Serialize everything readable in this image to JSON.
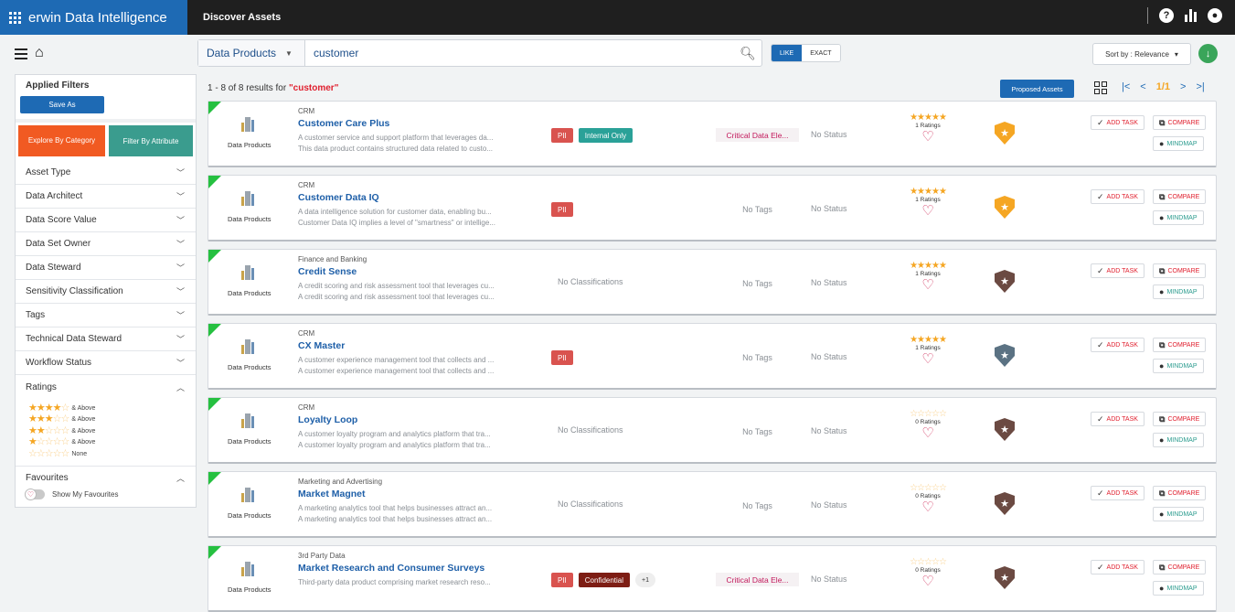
{
  "app": {
    "title": "erwin Data Intelligence",
    "page_title": "Discover Assets"
  },
  "header_icons": [
    "help-icon",
    "metrics-icon",
    "user-icon"
  ],
  "search": {
    "asset_type": "Data Products",
    "query": "customer",
    "match_modes": [
      "LIKE",
      "EXACT"
    ],
    "active_mode": "LIKE",
    "sort_by": "Sort by : Relevance"
  },
  "sidebar": {
    "applied_filters_label": "Applied Filters",
    "save_as_label": "Save As",
    "explore_by_category_label": "Explore By Category",
    "filter_by_attribute_label": "Filter By Attribute",
    "facets": [
      "Asset Type",
      "Data Architect",
      "Data Score Value",
      "Data Set Owner",
      "Data Steward",
      "Sensitivity Classification",
      "Tags",
      "Technical Data Steward",
      "Workflow Status"
    ],
    "ratings_label": "Ratings",
    "rating_filters": [
      {
        "stars": 4,
        "label": "& Above"
      },
      {
        "stars": 3,
        "label": "& Above"
      },
      {
        "stars": 2,
        "label": "& Above"
      },
      {
        "stars": 1,
        "label": "& Above"
      },
      {
        "stars": 0,
        "label": "None"
      }
    ],
    "favourites_label": "Favourites",
    "show_favourites_label": "Show My Favourites"
  },
  "results": {
    "summary_prefix": "1 - 8 of 8 results for ",
    "summary_query": "\"customer\"",
    "proposed_assets_label": "Proposed Assets",
    "pagination": {
      "first": "|<",
      "prev": "<",
      "page": "1/1",
      "next": ">",
      "last": ">|"
    }
  },
  "action_labels": {
    "add_task": "ADD TASK",
    "compare": "COMPARE",
    "mindmap": "MINDMAP"
  },
  "asset_type_label": "Data Products",
  "items": [
    {
      "domain": "CRM",
      "name": "Customer Care Plus",
      "desc1": "A customer service and support platform that leverages da...",
      "desc2": "This data product contains structured data related to custo...",
      "classifications": [
        "PII",
        "Internal Only"
      ],
      "no_class": "",
      "tags": "Critical Data Ele...",
      "status": "No Status",
      "stars": 5,
      "ratings": "1 Ratings",
      "shield": "gold"
    },
    {
      "domain": "CRM",
      "name": "Customer Data IQ",
      "desc1": "A data intelligence solution for customer data, enabling bu...",
      "desc2": "Customer Data IQ implies a level of \"smartness\" or intellige...",
      "classifications": [
        "PII"
      ],
      "no_class": "",
      "tags": "No Tags",
      "status": "No Status",
      "stars": 5,
      "ratings": "1 Ratings",
      "shield": "gold"
    },
    {
      "domain": "Finance and Banking",
      "name": "Credit Sense",
      "desc1": "A credit scoring and risk assessment tool that leverages cu...",
      "desc2": "A credit scoring and risk assessment tool that leverages cu...",
      "classifications": [],
      "no_class": "No Classifications",
      "tags": "No Tags",
      "status": "No Status",
      "stars": 5,
      "ratings": "1 Ratings",
      "shield": "brown"
    },
    {
      "domain": "CRM",
      "name": "CX Master",
      "desc1": "A customer experience management tool that collects and ...",
      "desc2": "A customer experience management tool that collects and ...",
      "classifications": [
        "PII"
      ],
      "no_class": "",
      "tags": "No Tags",
      "status": "No Status",
      "stars": 5,
      "ratings": "1 Ratings",
      "shield": "slate"
    },
    {
      "domain": "CRM",
      "name": "Loyalty Loop",
      "desc1": "A customer loyalty program and analytics platform that tra...",
      "desc2": "A customer loyalty program and analytics platform that tra...",
      "classifications": [],
      "no_class": "No Classifications",
      "tags": "No Tags",
      "status": "No Status",
      "stars": 0,
      "ratings": "0 Ratings",
      "shield": "brown"
    },
    {
      "domain": "Marketing and Advertising",
      "name": "Market Magnet",
      "desc1": "A marketing analytics tool that helps businesses attract an...",
      "desc2": "A marketing analytics tool that helps businesses attract an...",
      "classifications": [],
      "no_class": "No Classifications",
      "tags": "No Tags",
      "status": "No Status",
      "stars": 0,
      "ratings": "0 Ratings",
      "shield": "brown"
    },
    {
      "domain": "3rd Party Data",
      "name": "Market Research and Consumer Surveys",
      "desc1": "Third-party data product comprising market research reso...",
      "desc2": "",
      "classifications": [
        "PII",
        "Confidential",
        "+1"
      ],
      "no_class": "",
      "tags": "Critical Data Ele...",
      "status": "No Status",
      "stars": 0,
      "ratings": "0 Ratings",
      "shield": "brown"
    }
  ],
  "colors": {
    "brand_blue": "#1e6ab4",
    "accent_orange": "#f15a22",
    "teal": "#3a9c8e",
    "star": "#f5a623",
    "pii_red": "#d9534f"
  }
}
